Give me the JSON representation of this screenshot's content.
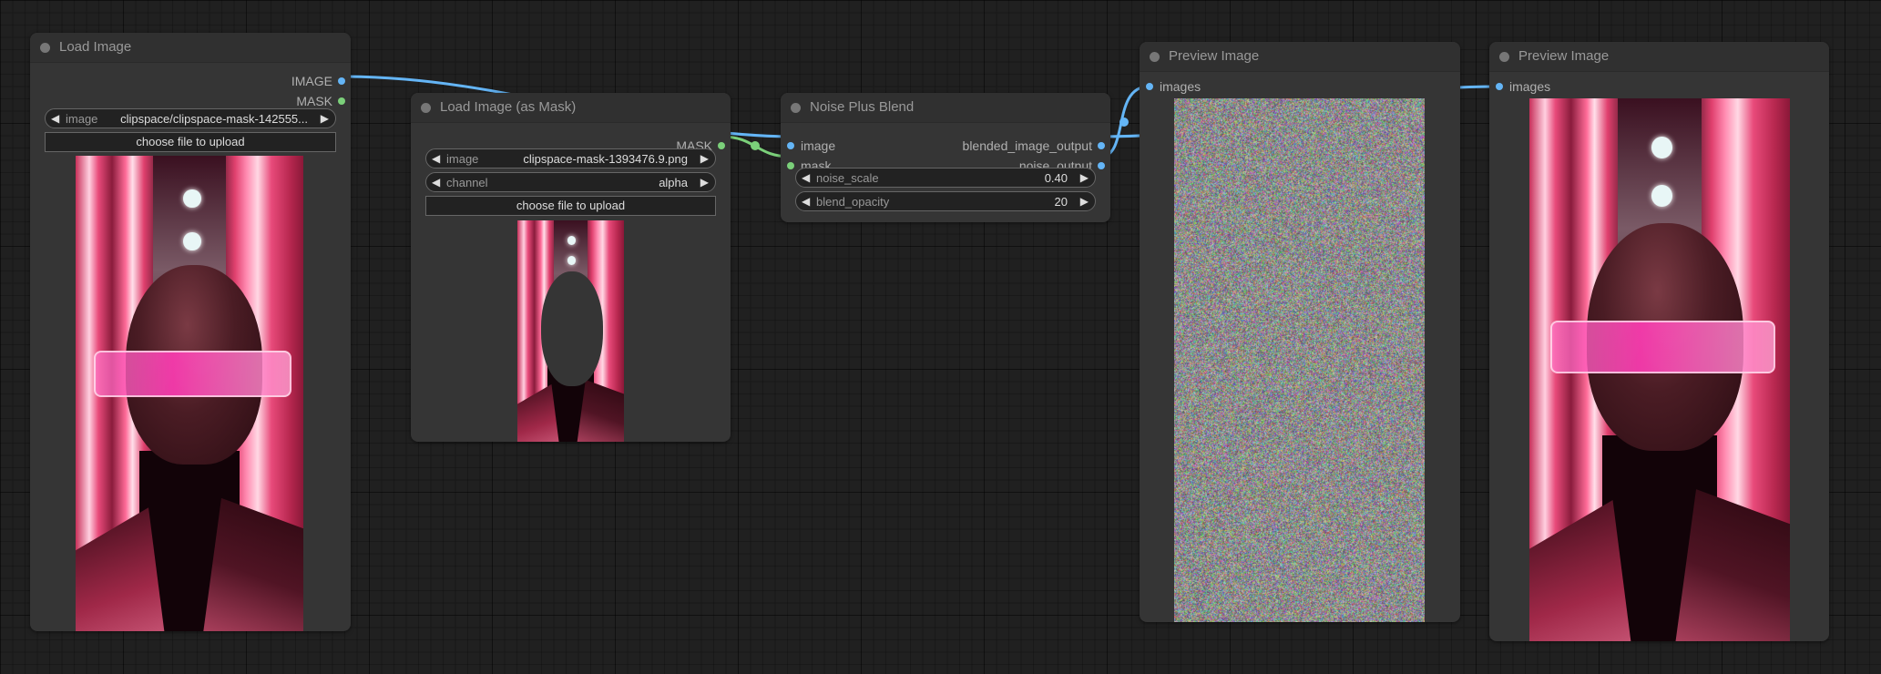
{
  "canvas": {
    "background": "#202020",
    "link_colors": {
      "IMAGE": "#64b5f6",
      "MASK": "#7bd07a"
    }
  },
  "nodes": {
    "load_image": {
      "title": "Load Image",
      "outputs": [
        {
          "label": "IMAGE",
          "type": "IMAGE"
        },
        {
          "label": "MASK",
          "type": "MASK"
        }
      ],
      "widgets": {
        "image": {
          "label": "image",
          "value": "clipspace/clipspace-mask-142555..."
        }
      },
      "upload_button": "choose file to upload",
      "preview_description": "portrait of bald woman wearing pink glasses in neon-lit corridor"
    },
    "load_image_mask": {
      "title": "Load Image (as Mask)",
      "outputs": [
        {
          "label": "MASK",
          "type": "MASK"
        }
      ],
      "widgets": {
        "image": {
          "label": "image",
          "value": "clipspace-mask-1393476.9.png"
        },
        "channel": {
          "label": "channel",
          "value": "alpha"
        }
      },
      "upload_button": "choose file to upload",
      "preview_description": "portrait with face region masked out"
    },
    "noise_plus_blend": {
      "title": "Noise Plus Blend",
      "inputs": [
        {
          "label": "image",
          "type": "IMAGE"
        },
        {
          "label": "mask",
          "type": "MASK"
        }
      ],
      "outputs": [
        {
          "label": "blended_image_output",
          "type": "IMAGE"
        },
        {
          "label": "noise_output",
          "type": "IMAGE"
        }
      ],
      "widgets": {
        "noise_scale": {
          "label": "noise_scale",
          "value": "0.40"
        },
        "blend_opacity": {
          "label": "blend_opacity",
          "value": "20"
        }
      }
    },
    "preview_noise": {
      "title": "Preview Image",
      "inputs": [
        {
          "label": "images",
          "type": "IMAGE"
        }
      ],
      "preview_description": "colored random noise image"
    },
    "preview_blend": {
      "title": "Preview Image",
      "inputs": [
        {
          "label": "images",
          "type": "IMAGE"
        }
      ],
      "preview_description": "blended portrait result"
    }
  },
  "icons": {
    "arrow_left": "◀",
    "arrow_right": "▶"
  }
}
